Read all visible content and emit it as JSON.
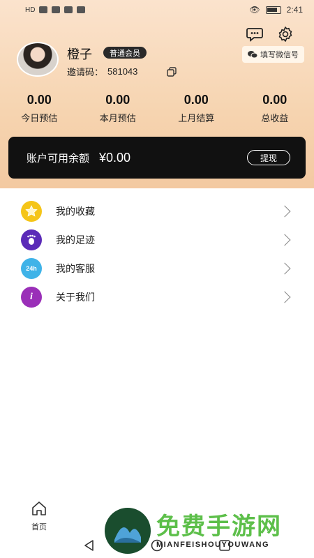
{
  "status_bar": {
    "time": "2:41",
    "left_icons": "HD"
  },
  "profile": {
    "name": "橙子",
    "badge": "普通会员",
    "invite_label": "邀请码：",
    "invite_code": "581043"
  },
  "header_actions": {
    "wechat_label": "填写微信号"
  },
  "stats": [
    {
      "value": "0.00",
      "label": "今日预估"
    },
    {
      "value": "0.00",
      "label": "本月预估"
    },
    {
      "value": "0.00",
      "label": "上月结算"
    },
    {
      "value": "0.00",
      "label": "总收益"
    }
  ],
  "balance": {
    "label": "账户可用余额",
    "amount": "¥0.00",
    "withdraw_label": "提现"
  },
  "menu": [
    {
      "label": "我的收藏",
      "icon": "star-icon",
      "color": "#f5c518"
    },
    {
      "label": "我的足迹",
      "icon": "footprint-icon",
      "color": "#5b2bb8"
    },
    {
      "label": "我的客服",
      "icon": "customer-service-icon",
      "color": "#3fb3e8"
    },
    {
      "label": "关于我们",
      "icon": "info-icon",
      "color": "#9a2fb8"
    }
  ],
  "bottom_nav": [
    {
      "label": "首页",
      "icon": "home-icon"
    },
    {
      "label": "",
      "icon": ""
    },
    {
      "label": "",
      "icon": ""
    },
    {
      "label": "",
      "icon": ""
    }
  ],
  "watermark": {
    "title": "免费手游网",
    "subtitle": "MIANFEISHOUYOUWANG"
  }
}
